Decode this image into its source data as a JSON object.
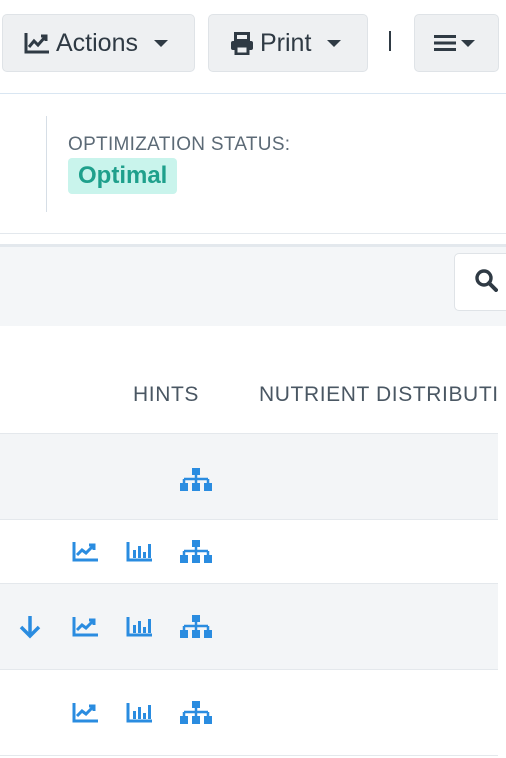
{
  "toolbar": {
    "actions_label": "Actions",
    "print_label": "Print",
    "separator": "|"
  },
  "status": {
    "label": "OPTIMIZATION STATUS:",
    "value": "Optimal",
    "colors": {
      "badge_bg": "#c9f4ec",
      "badge_text": "#1fa08c"
    }
  },
  "table": {
    "headers": [
      "HINTS",
      "NUTRIENT DISTRIBUTI"
    ],
    "rows": [
      {
        "icons": [
          "sitemap-icon"
        ]
      },
      {
        "icons": [
          "line-chart-icon",
          "bar-chart-icon",
          "sitemap-icon"
        ]
      },
      {
        "icons": [
          "arrow-down-icon",
          "line-chart-icon",
          "bar-chart-icon",
          "sitemap-icon"
        ]
      },
      {
        "icons": [
          "line-chart-icon",
          "bar-chart-icon",
          "sitemap-icon"
        ]
      }
    ]
  },
  "accent_color": "#2a8ce0"
}
